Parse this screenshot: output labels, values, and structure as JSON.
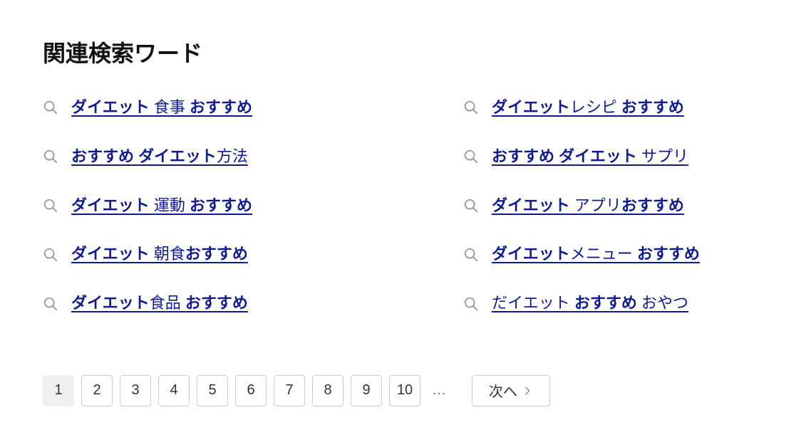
{
  "section": {
    "title": "関連検索ワード"
  },
  "related": [
    {
      "parts": [
        {
          "text": "ダイエット",
          "bold": true
        },
        {
          "text": " 食事 ",
          "bold": false
        },
        {
          "text": "おすすめ",
          "bold": true
        }
      ]
    },
    {
      "parts": [
        {
          "text": "ダイエット",
          "bold": true
        },
        {
          "text": "レシピ ",
          "bold": false
        },
        {
          "text": "おすすめ",
          "bold": true
        }
      ]
    },
    {
      "parts": [
        {
          "text": "おすすめ ダイエット",
          "bold": true
        },
        {
          "text": "方法",
          "bold": false
        }
      ]
    },
    {
      "parts": [
        {
          "text": "おすすめ ダイエット",
          "bold": true
        },
        {
          "text": " サプリ",
          "bold": false
        }
      ]
    },
    {
      "parts": [
        {
          "text": "ダイエット",
          "bold": true
        },
        {
          "text": " 運動 ",
          "bold": false
        },
        {
          "text": "おすすめ",
          "bold": true
        }
      ]
    },
    {
      "parts": [
        {
          "text": "ダイエット",
          "bold": true
        },
        {
          "text": " アプリ",
          "bold": false
        },
        {
          "text": "おすすめ",
          "bold": true
        }
      ]
    },
    {
      "parts": [
        {
          "text": "ダイエット",
          "bold": true
        },
        {
          "text": " 朝食",
          "bold": false
        },
        {
          "text": "おすすめ",
          "bold": true
        }
      ]
    },
    {
      "parts": [
        {
          "text": "ダイエット",
          "bold": true
        },
        {
          "text": "メニュー ",
          "bold": false
        },
        {
          "text": "おすすめ",
          "bold": true
        }
      ]
    },
    {
      "parts": [
        {
          "text": "ダイエット",
          "bold": true
        },
        {
          "text": "食品 ",
          "bold": false
        },
        {
          "text": "おすすめ",
          "bold": true
        }
      ]
    },
    {
      "parts": [
        {
          "text": "だイエット ",
          "bold": false
        },
        {
          "text": "おすすめ",
          "bold": true
        },
        {
          "text": " おやつ",
          "bold": false
        }
      ]
    }
  ],
  "pagination": {
    "current": 1,
    "pages": [
      1,
      2,
      3,
      4,
      5,
      6,
      7,
      8,
      9,
      10
    ],
    "ellipsis": "…",
    "next_label": "次へ"
  }
}
